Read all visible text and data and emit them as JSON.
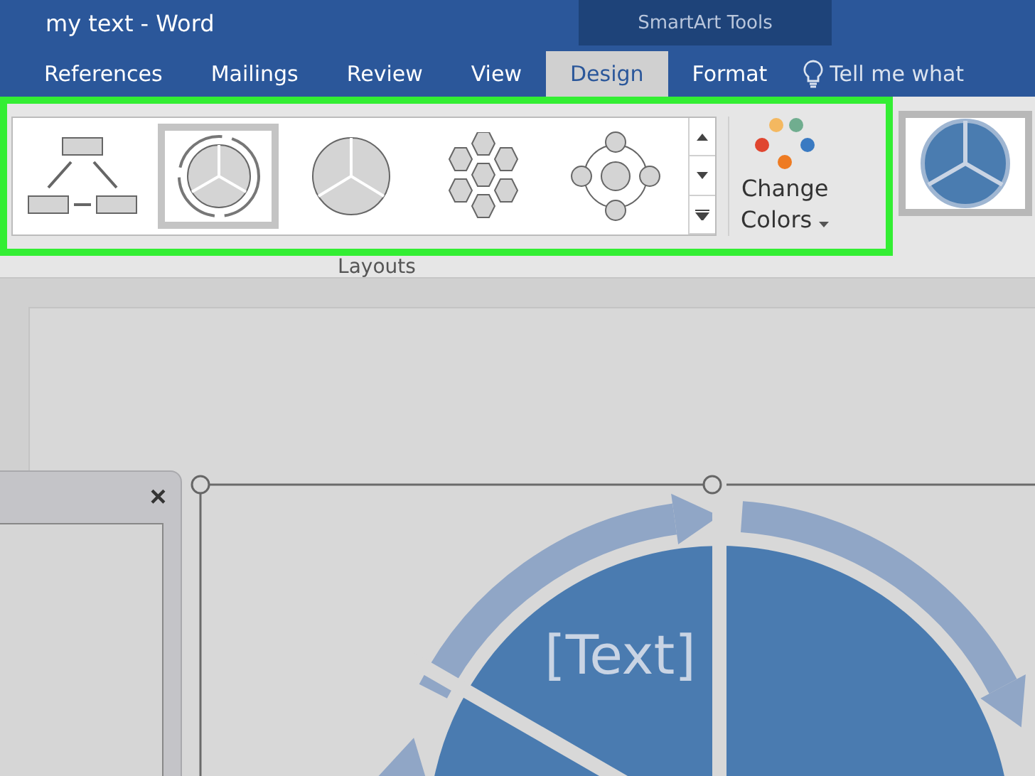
{
  "window": {
    "title": "my text - Word",
    "context_group": "SmartArt Tools"
  },
  "tabs": [
    {
      "label": "References",
      "selected": false
    },
    {
      "label": "Mailings",
      "selected": false
    },
    {
      "label": "Review",
      "selected": false
    },
    {
      "label": "View",
      "selected": false
    },
    {
      "label": "Design",
      "selected": true
    },
    {
      "label": "Format",
      "selected": false
    }
  ],
  "tell_me": {
    "label": "Tell me what"
  },
  "layouts": {
    "items": [
      {
        "kind": "hierarchy",
        "selected": false
      },
      {
        "kind": "cycle",
        "selected": true
      },
      {
        "kind": "pie",
        "selected": false
      },
      {
        "kind": "hexagon",
        "selected": false
      },
      {
        "kind": "radial",
        "selected": false
      }
    ],
    "group_label": "Layouts"
  },
  "change_colors": {
    "line_1": "Change",
    "line_2": "Colors"
  },
  "text_pane": {
    "close": "×"
  },
  "smartart": {
    "shape_text": "[Text]"
  }
}
